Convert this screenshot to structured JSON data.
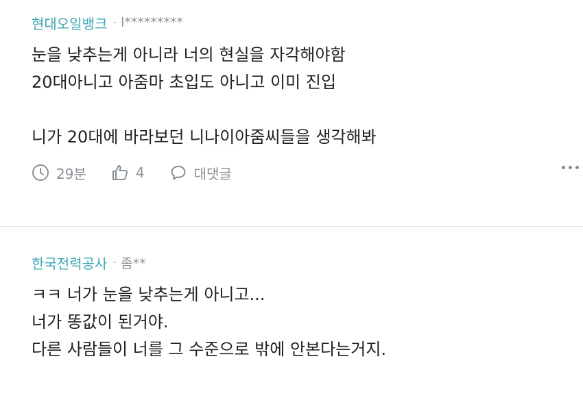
{
  "comments": [
    {
      "company": "현대오일뱅크",
      "dot": "·",
      "author": "l*********",
      "lines": [
        "눈을 낮추는게 아니라 너의 현실을 자각해야함",
        "20대아니고 아줌마 초입도 아니고 이미 진입",
        "",
        "니가 20대에 바라보던 니나이아줌씨들을 생각해봐"
      ],
      "time": "29분",
      "likes": "4",
      "reply_label": "대댓글"
    },
    {
      "company": "한국전력공사",
      "dot": "·",
      "author": "좀**",
      "lines": [
        "ㅋㅋ 너가 눈을 낮추는게 아니고...",
        "너가 똥값이 된거야.",
        "다른 사람들이 너를 그 수준으로 밖에 안본다는거지."
      ]
    }
  ]
}
